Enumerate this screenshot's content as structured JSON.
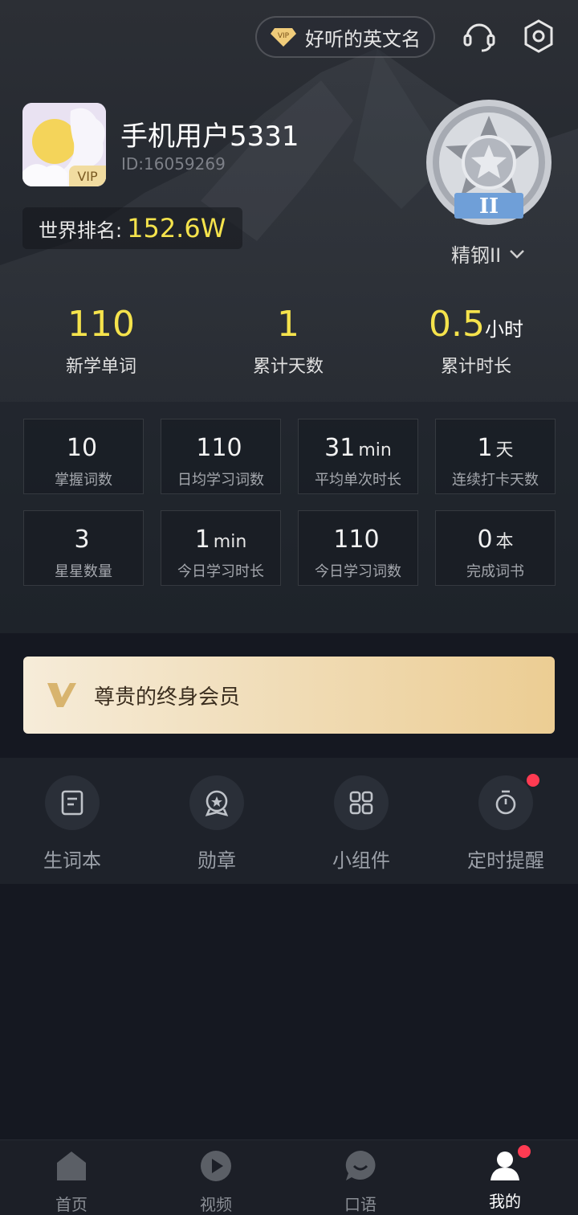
{
  "header": {
    "vip_name_button": "好听的英文名",
    "vip_icon_text": "VIP"
  },
  "profile": {
    "username": "手机用户5331",
    "user_id": "ID:16059269",
    "avatar_tag": "VIP",
    "rank_label": "世界排名:",
    "rank_value": "152.6W",
    "badge_name": "精钢II",
    "badge_roman": "II"
  },
  "big_stats": [
    {
      "value": "110",
      "unit": "",
      "caption": "新学单词"
    },
    {
      "value": "1",
      "unit": "",
      "caption": "累计天数"
    },
    {
      "value": "0.5",
      "unit": "小时",
      "caption": "累计时长"
    }
  ],
  "grid_stats": [
    {
      "value": "10",
      "unit": "",
      "caption": "掌握词数"
    },
    {
      "value": "110",
      "unit": "",
      "caption": "日均学习词数"
    },
    {
      "value": "31",
      "unit": "min",
      "caption": "平均单次时长"
    },
    {
      "value": "1",
      "unit": "天",
      "caption": "连续打卡天数"
    },
    {
      "value": "3",
      "unit": "",
      "caption": "星星数量"
    },
    {
      "value": "1",
      "unit": "min",
      "caption": "今日学习时长"
    },
    {
      "value": "110",
      "unit": "",
      "caption": "今日学习词数"
    },
    {
      "value": "0",
      "unit": "本",
      "caption": "完成词书"
    }
  ],
  "member_banner": {
    "label": "尊贵的终身会员"
  },
  "tools": [
    {
      "label": "生词本",
      "icon": "notebook-icon"
    },
    {
      "label": "勋章",
      "icon": "medal-icon"
    },
    {
      "label": "小组件",
      "icon": "widgets-icon"
    },
    {
      "label": "定时提醒",
      "icon": "timer-icon"
    }
  ],
  "bottom_nav": [
    {
      "label": "首页",
      "icon": "home-icon"
    },
    {
      "label": "视频",
      "icon": "video-icon"
    },
    {
      "label": "口语",
      "icon": "chat-icon"
    },
    {
      "label": "我的",
      "icon": "profile-icon"
    }
  ],
  "colors": {
    "accent_yellow": "#f5e34c",
    "gold_banner": "#eccd93",
    "notify_red": "#ff3b52"
  }
}
